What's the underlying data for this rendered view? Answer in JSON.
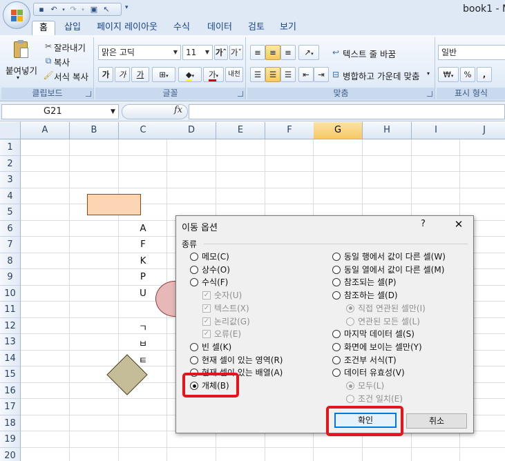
{
  "window": {
    "title": "book1 - M"
  },
  "qat": {
    "icons": [
      "save-icon",
      "undo-icon",
      "redo-icon",
      "print-preview-icon",
      "pointer-icon",
      "customize-icon"
    ]
  },
  "tabs": [
    {
      "label": "홈",
      "active": true
    },
    {
      "label": "삽입"
    },
    {
      "label": "페이지 레이아웃"
    },
    {
      "label": "수식"
    },
    {
      "label": "데이터"
    },
    {
      "label": "검토"
    },
    {
      "label": "보기"
    }
  ],
  "ribbon": {
    "clipboard": {
      "label": "클립보드",
      "paste": "붙여넣기",
      "cut": "잘라내기",
      "copy": "복사",
      "format_painter": "서식 복사"
    },
    "font": {
      "label": "글꼴",
      "font_name": "맑은 고딕",
      "font_size": "11",
      "bold": "가",
      "italic": "가",
      "underline": "가",
      "font_color_glyph": "가",
      "phonetic": "내천"
    },
    "alignment": {
      "label": "맞춤",
      "wrap_text": "텍스트 줄 바꿈",
      "merge_center": "병합하고 가운데 맞춤"
    },
    "number": {
      "label": "표시 형식",
      "format": "일반",
      "currency": "₩",
      "percent": "%",
      "comma": ","
    }
  },
  "formula_bar": {
    "name_box": "G21",
    "fx": "fx",
    "formula": ""
  },
  "sheet": {
    "columns": [
      "A",
      "B",
      "C",
      "D",
      "E",
      "F",
      "G",
      "H",
      "I",
      "J"
    ],
    "selected_column": "G",
    "rows": [
      "1",
      "2",
      "3",
      "4",
      "5",
      "6",
      "7",
      "8",
      "9",
      "10",
      "11",
      "12",
      "13",
      "14",
      "15",
      "16",
      "17",
      "18",
      "19",
      "20"
    ],
    "cells": [
      {
        "ref": "C6",
        "value": "A"
      },
      {
        "ref": "C7",
        "value": "F"
      },
      {
        "ref": "C8",
        "value": "K"
      },
      {
        "ref": "C9",
        "value": "P"
      },
      {
        "ref": "C10",
        "value": "U"
      },
      {
        "ref": "C12",
        "value": "ㄱ"
      },
      {
        "ref": "C13",
        "value": "ㅂ"
      },
      {
        "ref": "C14",
        "value": "ㅌ"
      }
    ],
    "shapes": [
      {
        "type": "rectangle",
        "fill": "#fcd5b5",
        "stroke": "#974806"
      },
      {
        "type": "oval",
        "fill": "#e6b9b8",
        "stroke": "#953735"
      },
      {
        "type": "diamond",
        "fill": "#c4bd97",
        "stroke": "#4a452a"
      }
    ]
  },
  "dialog": {
    "title": "이동 옵션",
    "help": "?",
    "close": "✕",
    "group_label": "종류",
    "left_options": [
      {
        "label": "메모(C)",
        "type": "radio"
      },
      {
        "label": "상수(O)",
        "type": "radio"
      },
      {
        "label": "수식(F)",
        "type": "radio"
      },
      {
        "label": "숫자(U)",
        "type": "checkbox",
        "disabled": true
      },
      {
        "label": "텍스트(X)",
        "type": "checkbox",
        "disabled": true
      },
      {
        "label": "논리값(G)",
        "type": "checkbox",
        "disabled": true
      },
      {
        "label": "오류(E)",
        "type": "checkbox",
        "disabled": true
      },
      {
        "label": "빈 셀(K)",
        "type": "radio"
      },
      {
        "label": "현재 셀이 있는 영역(R)",
        "type": "radio"
      },
      {
        "label": "현재 셀이 있는 배열(A)",
        "type": "radio"
      },
      {
        "label": "개체(B)",
        "type": "radio",
        "checked": true
      }
    ],
    "right_options": [
      {
        "label": "동일 행에서 값이 다른 셀(W)",
        "type": "radio"
      },
      {
        "label": "동일 열에서 값이 다른 셀(M)",
        "type": "radio"
      },
      {
        "label": "참조되는 셀(P)",
        "type": "radio"
      },
      {
        "label": "참조하는 셀(D)",
        "type": "radio"
      },
      {
        "label": "직접 연관된 셀만(I)",
        "type": "radio",
        "checked": true,
        "disabled": true
      },
      {
        "label": "연관된 모든 셀(L)",
        "type": "radio",
        "disabled": true
      },
      {
        "label": "마지막 데이터 셀(S)",
        "type": "radio"
      },
      {
        "label": "화면에 보이는 셀만(Y)",
        "type": "radio"
      },
      {
        "label": "조건부 서식(T)",
        "type": "radio"
      },
      {
        "label": "데이터 유효성(V)",
        "type": "radio"
      },
      {
        "label": "모두(L)",
        "type": "radio",
        "checked": true,
        "disabled": true
      },
      {
        "label": "조건 일치(E)",
        "type": "radio",
        "disabled": true
      }
    ],
    "ok": "확인",
    "cancel": "취소",
    "highlight_color": "#e8121b"
  }
}
